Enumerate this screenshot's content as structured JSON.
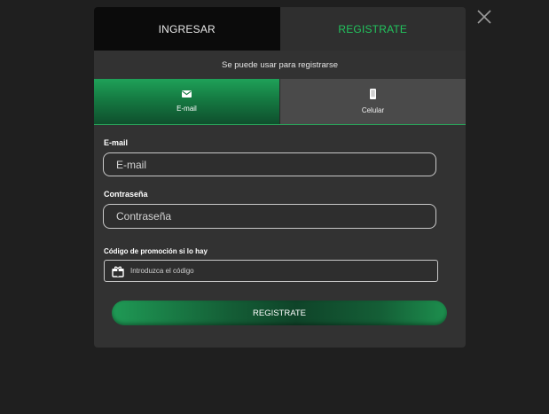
{
  "tabs": {
    "login": "INGRESAR",
    "register": "REGISTRATE"
  },
  "subtitle": "Se puede usar para registrarse",
  "methods": {
    "email": "E-mail",
    "phone": "Celular"
  },
  "form": {
    "email_label": "E-mail",
    "email_placeholder": "E-mail",
    "password_label": "Contraseña",
    "password_placeholder": "Contraseña",
    "promo_label": "Código de promoción si lo hay",
    "promo_placeholder": "Introduzca el código"
  },
  "submit_label": "REGISTRATE",
  "colors": {
    "accent": "#22c55e",
    "button_green": "#157a42",
    "background": "#1f1f1f",
    "panel": "#323232"
  },
  "icons": {
    "close": "close-icon",
    "email": "envelope-icon",
    "phone": "mobile-phone-icon",
    "promo": "gift-icon"
  }
}
